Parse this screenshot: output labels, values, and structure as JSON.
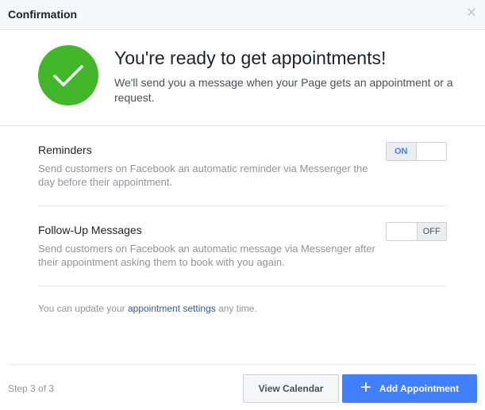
{
  "dialog": {
    "title": "Confirmation",
    "close_icon": "close-icon"
  },
  "hero": {
    "icon": "checkmark-circle-icon",
    "icon_color": "#42b72a",
    "title": "You're ready to get appointments!",
    "description": "We'll send you a message when your Page gets an appointment or a request."
  },
  "settings": [
    {
      "title": "Reminders",
      "description": "Send customers on Facebook an automatic reminder via Messenger the day before their appointment.",
      "toggle_label": "ON",
      "enabled": true
    },
    {
      "title": "Follow-Up Messages",
      "description": "Send customers on Facebook an automatic message via Messenger after their appointment asking them to book with you again.",
      "toggle_label": "OFF",
      "enabled": false
    }
  ],
  "note": {
    "prefix": "You can update your ",
    "link": "appointment settings",
    "suffix": " any time."
  },
  "footer": {
    "step": "Step 3 of 3",
    "secondary_button": "View Calendar",
    "primary_button": "Add Appointment",
    "primary_icon": "plus-icon",
    "primary_color": "#4080ff"
  }
}
